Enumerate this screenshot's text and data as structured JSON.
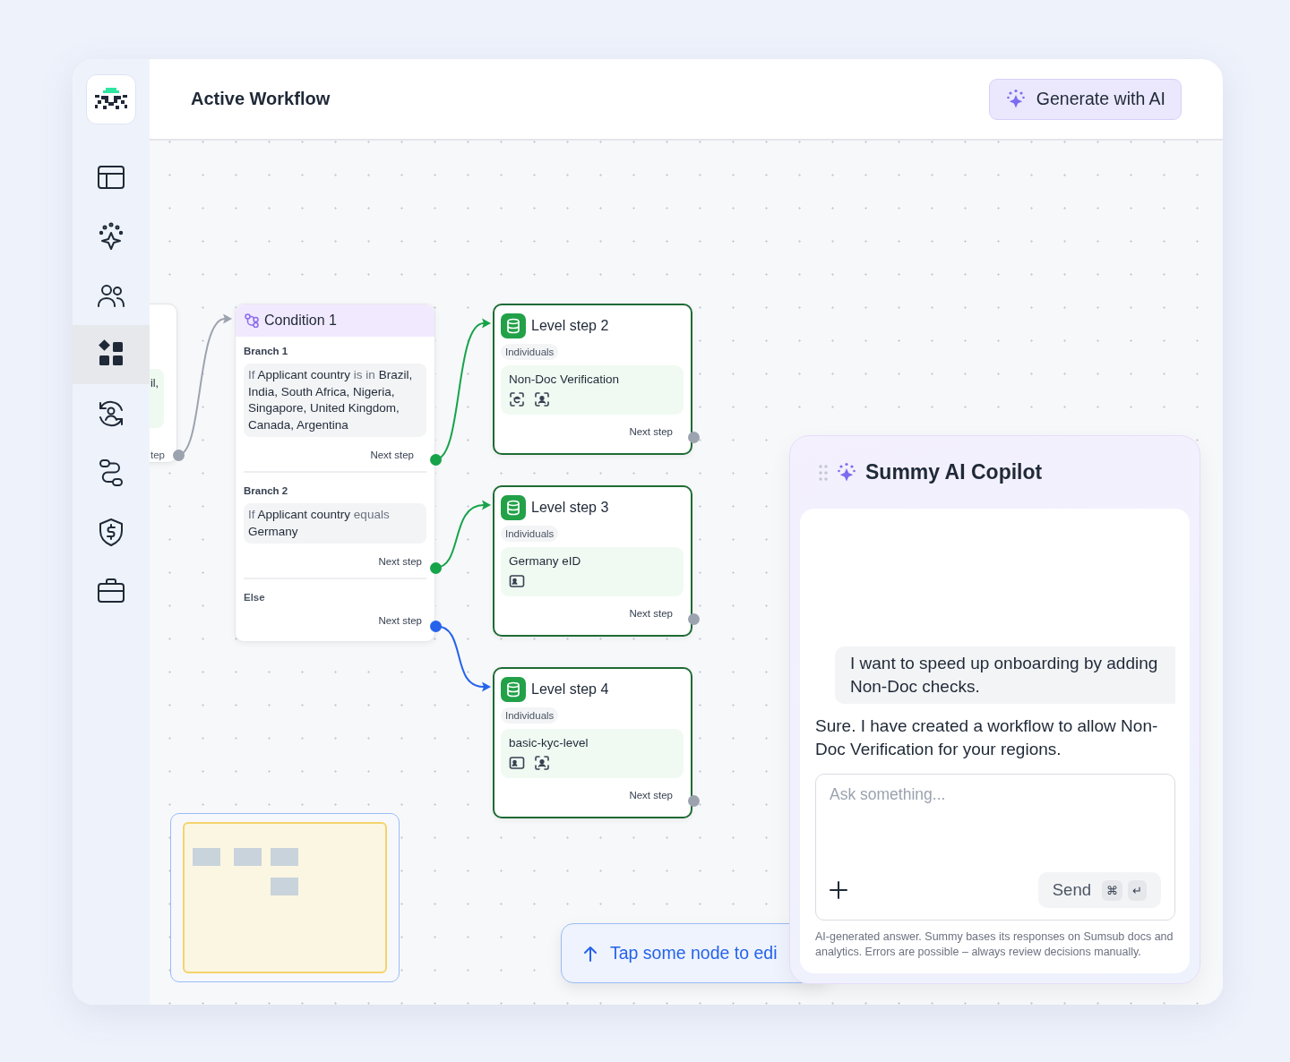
{
  "header": {
    "title": "Active Workflow",
    "ai_button": "Generate with AI"
  },
  "sidebar": {
    "items": [
      {
        "kind": "layout",
        "selected": false
      },
      {
        "kind": "sparkle",
        "selected": false
      },
      {
        "kind": "users",
        "selected": false
      },
      {
        "kind": "apps",
        "selected": true
      },
      {
        "kind": "user-sync",
        "selected": false
      },
      {
        "kind": "route",
        "selected": false
      },
      {
        "kind": "shield-dollar",
        "selected": false
      },
      {
        "kind": "briefcase",
        "selected": false
      }
    ]
  },
  "canvas": {
    "partial_node": {
      "line": "il,",
      "next_step": "tep",
      "color": "#9ca3af"
    },
    "condition": {
      "title": "Condition 1",
      "branches": [
        {
          "label": "Branch 1",
          "condition": [
            {
              "kind": "operator",
              "text": "If"
            },
            {
              "kind": "value",
              "text": "Applicant country"
            },
            {
              "kind": "operator",
              "text": "is in"
            },
            {
              "kind": "value",
              "text": "Brazil, India, South Africa, Nigeria, Singapore, United Kingdom, Canada, Argentina"
            }
          ],
          "next_step": "Next step",
          "color": "#16a34a"
        },
        {
          "label": "Branch 2",
          "condition": [
            {
              "kind": "operator",
              "text": "If"
            },
            {
              "kind": "value",
              "text": "Applicant country"
            },
            {
              "kind": "operator",
              "text": "equals"
            },
            {
              "kind": "value",
              "text": "Germany"
            }
          ],
          "next_step": "Next step",
          "color": "#16a34a"
        },
        {
          "label": "Else",
          "next_step": "Next step",
          "color": "#2563eb"
        }
      ]
    },
    "level_steps": [
      {
        "title": "Level step 2",
        "tag": "Individuals",
        "check": "Non-Doc Verification",
        "icons": [
          {
            "kind": "eid-scan"
          },
          {
            "kind": "face-scan"
          }
        ],
        "next_step": "Next step"
      },
      {
        "title": "Level step 3",
        "tag": "Individuals",
        "check": "Germany eID",
        "icons": [
          {
            "kind": "id-card"
          }
        ],
        "next_step": "Next step"
      },
      {
        "title": "Level step 4",
        "tag": "Individuals",
        "check": "basic-kyc-level",
        "icons": [
          {
            "kind": "id-card"
          },
          {
            "kind": "face-scan"
          }
        ],
        "next_step": "Next step"
      }
    ],
    "toast": {
      "text": "Tap some node to edi"
    }
  },
  "copilot": {
    "title": "Summy AI Copilot",
    "messages": [
      {
        "kind": "user",
        "text": "I want to speed up onboarding by adding Non-Doc checks."
      },
      {
        "kind": "assistant",
        "text": "Sure. I have created a workflow to allow Non-Doc Verification for your regions."
      }
    ],
    "input": {
      "placeholder": "Ask something..."
    },
    "send": {
      "label": "Send",
      "keys": [
        "⌘",
        "↵"
      ]
    },
    "disclaimer": "AI-generated answer. Summy bases its responses on Sumsub docs and analytics. Errors are possible – always review decisions manually."
  }
}
